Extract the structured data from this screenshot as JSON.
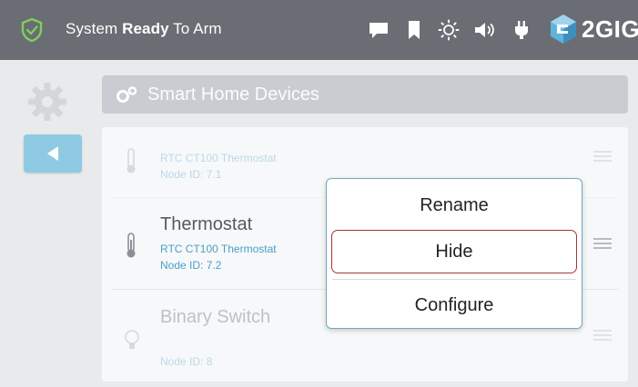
{
  "status_bar": {
    "status_prefix": "System ",
    "status_bold": "Ready",
    "status_suffix": " To Arm",
    "brand": "2GIG",
    "icons": [
      "message-icon",
      "bookmark-icon",
      "brightness-icon",
      "volume-icon",
      "power-plug-icon"
    ]
  },
  "header": {
    "title": "Smart Home Devices"
  },
  "devices": [
    {
      "name": "",
      "subtitle": "RTC CT100 Thermostat",
      "node": "Node ID: 7.1",
      "icon": "thermostat-icon"
    },
    {
      "name": "Thermostat",
      "subtitle": "RTC CT100 Thermostat",
      "node": "Node ID: 7.2",
      "icon": "thermostat-icon"
    },
    {
      "name": "Binary Switch",
      "subtitle": "",
      "node": "Node ID: 8",
      "icon": "lightbulb-icon"
    }
  ],
  "context_menu": {
    "rename": "Rename",
    "hide": "Hide",
    "configure": "Configure"
  },
  "colors": {
    "topbar": "#6a6d73",
    "accent_blue": "#8ecbe2",
    "link_blue": "#4aa0c9",
    "highlight_red": "#a4343a",
    "shield_green": "#7fcf5a"
  }
}
